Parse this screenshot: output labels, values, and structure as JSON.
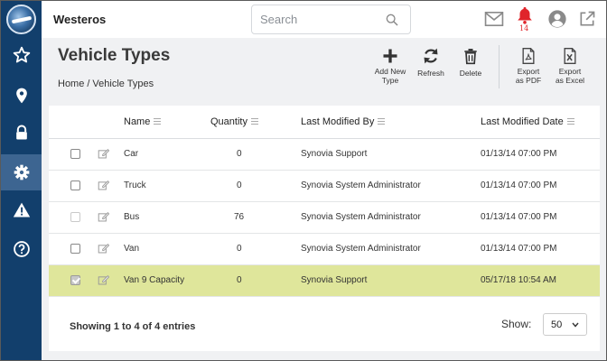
{
  "app": {
    "title": "Westeros"
  },
  "search": {
    "placeholder": "Search"
  },
  "notifications": {
    "count": "14"
  },
  "colors": {
    "sidebar": "#123f6c",
    "sidebar_active": "#3d6591",
    "selected_row": "#dfe69b",
    "bell": "#e0242b"
  },
  "sidebar": {
    "items": [
      {
        "icon": "star-icon"
      },
      {
        "icon": "map-pin-icon"
      },
      {
        "icon": "lock-icon"
      },
      {
        "icon": "gear-icon",
        "active": true
      },
      {
        "icon": "warning-icon"
      },
      {
        "icon": "help-icon"
      }
    ]
  },
  "page": {
    "title": "Vehicle Types",
    "breadcrumb": {
      "home": "Home",
      "separator": "/",
      "current": "Vehicle Types"
    }
  },
  "toolbar": {
    "add_line1": "Add New",
    "add_line2": "Type",
    "refresh": "Refresh",
    "delete": "Delete",
    "pdf_line1": "Export",
    "pdf_line2": "as PDF",
    "excel_line1": "Export",
    "excel_line2": "as Excel"
  },
  "table": {
    "headers": {
      "name": "Name",
      "quantity": "Quantity",
      "modified_by": "Last Modified By",
      "modified_date": "Last Modified Date"
    },
    "rows": [
      {
        "name": "Car",
        "quantity": "0",
        "modified_by": "Synovia Support",
        "modified_date": "01/13/14 07:00 PM",
        "checkbox": "unchecked"
      },
      {
        "name": "Truck",
        "quantity": "0",
        "modified_by": "Synovia System Administrator",
        "modified_date": "01/13/14 07:00 PM",
        "checkbox": "unchecked"
      },
      {
        "name": "Bus",
        "quantity": "76",
        "modified_by": "Synovia System Administrator",
        "modified_date": "01/13/14 07:00 PM",
        "checkbox": "disabled"
      },
      {
        "name": "Van",
        "quantity": "0",
        "modified_by": "Synovia System Administrator",
        "modified_date": "01/13/14 07:00 PM",
        "checkbox": "unchecked"
      },
      {
        "name": "Van 9 Capacity",
        "quantity": "0",
        "modified_by": "Synovia Support",
        "modified_date": "05/17/18 10:54 AM",
        "checkbox": "checked",
        "selected": true
      }
    ]
  },
  "footer": {
    "entries": "Showing 1 to 4 of 4 entries",
    "show_label": "Show:",
    "page_size": "50"
  }
}
